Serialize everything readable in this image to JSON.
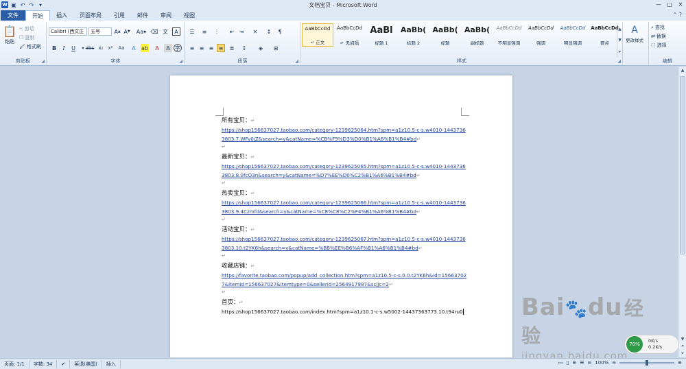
{
  "window": {
    "title": "文档宝贝 - Microsoft Word"
  },
  "qat": {
    "icons": [
      "word-icon",
      "save-icon",
      "undo-icon",
      "redo-icon"
    ]
  },
  "tabs": [
    "文件",
    "开始",
    "插入",
    "页面布局",
    "引用",
    "邮件",
    "审阅",
    "视图"
  ],
  "ribbon": {
    "clipboard": {
      "title": "剪贴板",
      "paste": "粘贴",
      "cut": "剪切",
      "copy": "复制",
      "format_painter": "格式刷"
    },
    "font": {
      "title": "字体",
      "font_name": "Calibri (西文正",
      "font_size": "五号"
    },
    "paragraph": {
      "title": "段落"
    },
    "styles": {
      "title": "样式",
      "change_styles": "更改样式",
      "items": [
        {
          "preview": "AaBbCcDd",
          "name": "↵ 正文"
        },
        {
          "preview": "AaBbCcDd",
          "name": "↵ 无间隔"
        },
        {
          "preview": "AaBl",
          "name": "标题 1"
        },
        {
          "preview": "AaBb(",
          "name": "标题 2"
        },
        {
          "preview": "AaBb(",
          "name": "标题"
        },
        {
          "preview": "AaBb(",
          "name": "副标题"
        },
        {
          "preview": "AaBbCcDd",
          "name": "不明显强调"
        },
        {
          "preview": "AaBbCcDd",
          "name": "强调"
        },
        {
          "preview": "AaBbCcDd",
          "name": "明显强调"
        },
        {
          "preview": "AaBbCcDd",
          "name": "要点"
        }
      ]
    },
    "editing": {
      "title": "编辑",
      "find": "查找",
      "replace": "替换",
      "select": "选择"
    }
  },
  "document": {
    "sections": [
      {
        "heading": "所有宝贝：",
        "link": "https://shop156637027.taobao.com/category-1239625064.htm?spm=a1z10.5-c-s.w4010-14437363803.7.WFy0jZ&search=y&catName=%CB%F9%D3%D0%B1%A6%B1%B4#bd"
      },
      {
        "heading": "最新宝贝：",
        "link": "https://shop156637027.taobao.com/category-1239625065.htm?spm=a1z10.5-c-s.w4010-14437363803.8.0fcO3n&search=y&catName=%D7%EE%D0%C2%B1%A6%B1%B4#bd"
      },
      {
        "heading": "热卖宝贝：",
        "link": "https://shop156637027.taobao.com/category-1239625066.htm?spm=a1z10.5-c-s.w4010-14437363803.9.4Czmfd&search=y&catName=%C8%C8%C2%F4%B1%A6%B1%B4#bd"
      },
      {
        "heading": "活动宝贝：",
        "link": "https://shop156637027.taobao.com/category-1239625067.htm?spm=a1z10.5-c-s.w4010-14437363803.10.t2YK6h&search=y&catName=%BB%EE%B6%AF%B1%A6%B1%B4#bd"
      },
      {
        "heading": "收藏店铺：",
        "link": "https://favorite.taobao.com/popup/add_collection.htm?spm=a1z10.5-c-s.0.0.t2YK6h&id=156637027&itemid=156637027&itemtype=0&sellerid=2564917987&scjjc=2"
      }
    ],
    "last": {
      "heading": "首页：",
      "text": "https://shop156637027.taobao.com/index.htm?spm=a1z10.1-c-s.w5002-14437363773.10.t94ru0"
    },
    "para_mark": "↵"
  },
  "watermark": {
    "logo": "Bai",
    "logo2": "du",
    "cn": "经验",
    "url": "jingyan.baidu.com"
  },
  "speed": {
    "percent": "70%",
    "up": "0K/s",
    "down": "0.2K/s"
  },
  "status": {
    "page": "页面: 1/1",
    "words": "字数: 34",
    "language": "英语(美国)",
    "mode": "插入",
    "zoom": "100%"
  },
  "colors": {
    "file_tab": "#2a5ea8",
    "link": "#1f3f9e",
    "ribbon_bg": "#e4ecf7"
  }
}
